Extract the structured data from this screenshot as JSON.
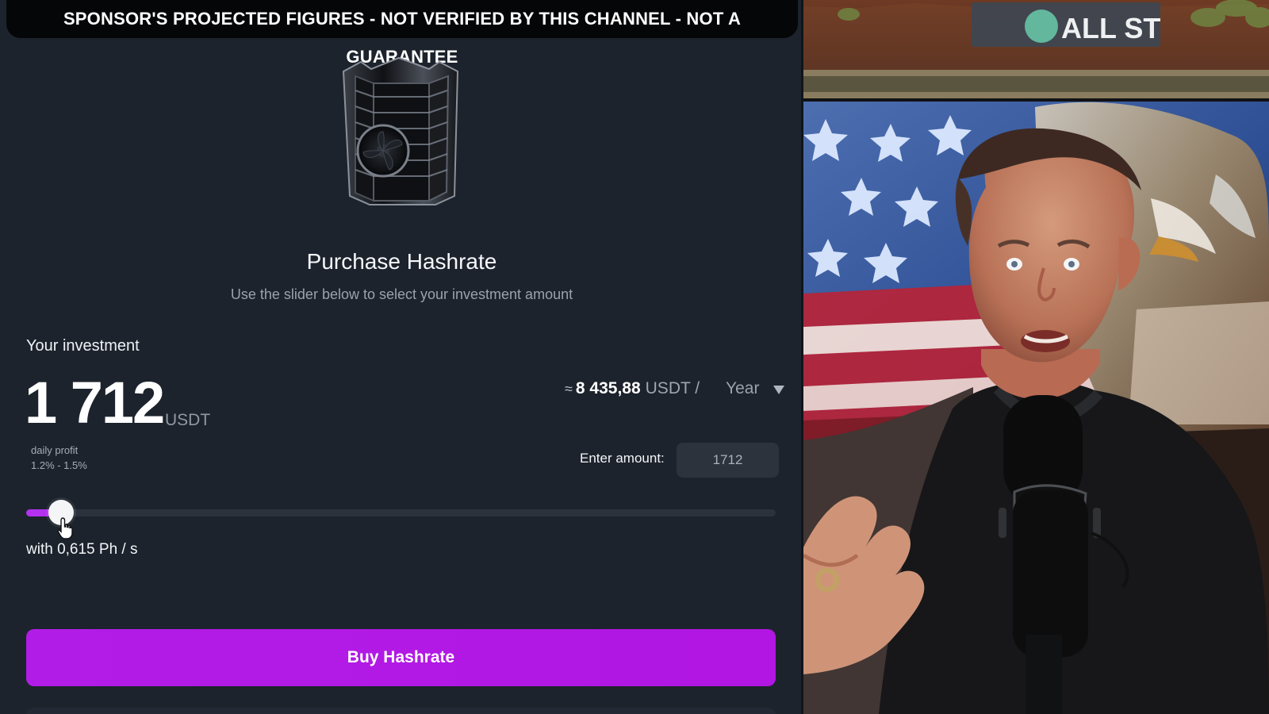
{
  "disclaimer": {
    "text": "SPONSOR'S PROJECTED FIGURES - NOT VERIFIED BY THIS CHANNEL - NOT A GUARANTEE"
  },
  "purchase": {
    "title": "Purchase Hashrate",
    "subtitle": "Use the slider below to select your investment amount"
  },
  "investment": {
    "label": "Your investment",
    "value": "1 712",
    "unit": "USDT",
    "daily_profit_label": "daily profit",
    "daily_profit_range": "1.2% - 1.5%"
  },
  "projection": {
    "approx": "≈",
    "value": "8 435,88",
    "unit": "USDT /",
    "period": "Year"
  },
  "amount": {
    "label": "Enter amount:",
    "value": "1712"
  },
  "slider": {
    "fraction": 0.047
  },
  "hashrate": {
    "text": "with 0,615 Ph / s"
  },
  "buy_button": {
    "label": "Buy Hashrate"
  },
  "webcam": {
    "sign_text": "ALL ST"
  },
  "icons": {
    "miner": "crypto-miner-icon",
    "cursor": "hand-cursor-icon",
    "dropdown": "chevron-down-icon"
  }
}
